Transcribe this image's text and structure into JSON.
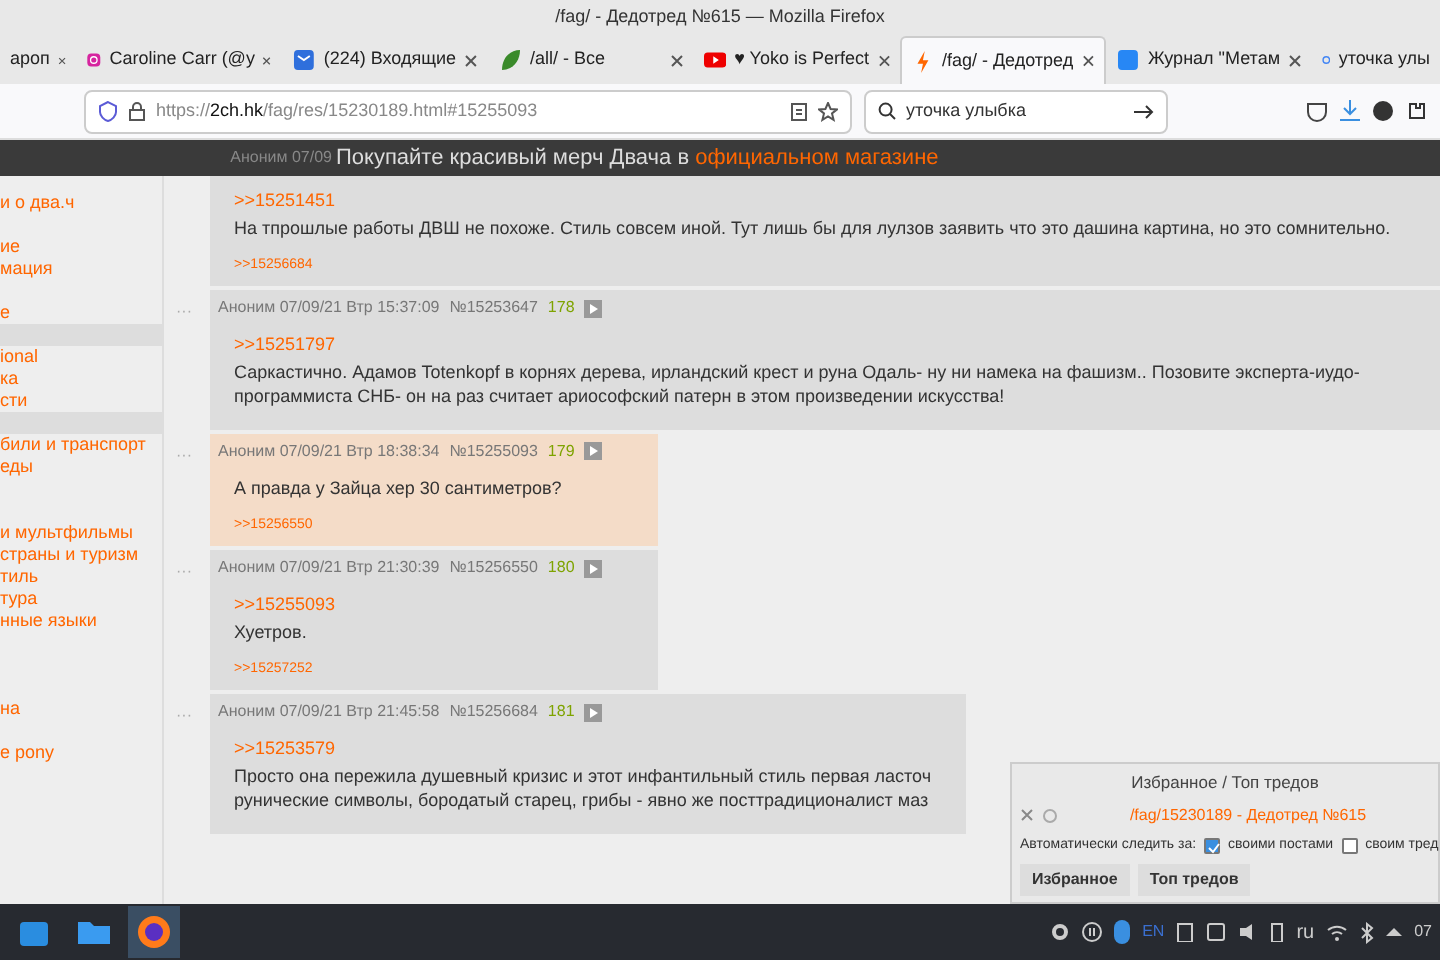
{
  "window": {
    "title": "/fag/ - Дедотред №615 — Mozilla Firefox"
  },
  "tabs": [
    {
      "label": "ароп",
      "selected": false
    },
    {
      "label": "Caroline Carr (@y",
      "selected": false
    },
    {
      "label": "(224) Входящие",
      "selected": false
    },
    {
      "label": "/all/ - Все",
      "selected": false
    },
    {
      "label": "♥ Yoko is Perfect",
      "selected": false
    },
    {
      "label": "/fag/ - Дедотред",
      "selected": true
    },
    {
      "label": "Журнал \"Метам",
      "selected": false
    },
    {
      "label": "уточка улы",
      "selected": false
    }
  ],
  "url_bar": {
    "scheme": "https://",
    "host": "2ch.hk",
    "path": "/fag/res/15230189.html#15255093"
  },
  "search": {
    "value": "уточка улыбка"
  },
  "banner": {
    "behind_text": "Аноним 07/09",
    "text": "Покупайте красивый мерч Двача в ",
    "link": "официальном магазине"
  },
  "sidebar": {
    "items": [
      {
        "kind": "link",
        "label": "и о два.ч"
      },
      {
        "kind": "gap"
      },
      {
        "kind": "link",
        "label": "ие"
      },
      {
        "kind": "link",
        "label": "мация"
      },
      {
        "kind": "gap"
      },
      {
        "kind": "link",
        "label": "е"
      },
      {
        "kind": "header"
      },
      {
        "kind": "link",
        "label": "ional"
      },
      {
        "kind": "link",
        "label": "ка"
      },
      {
        "kind": "link",
        "label": "сти"
      },
      {
        "kind": "header"
      },
      {
        "kind": "link",
        "label": "били и транспорт"
      },
      {
        "kind": "link",
        "label": "еды"
      },
      {
        "kind": "gap"
      },
      {
        "kind": "gap"
      },
      {
        "kind": "link",
        "label": "и мультфильмы"
      },
      {
        "kind": "link",
        "label": "страны и туризм"
      },
      {
        "kind": "link",
        "label": "тиль"
      },
      {
        "kind": "link",
        "label": "тура"
      },
      {
        "kind": "link",
        "label": "нные языки"
      },
      {
        "kind": "gap"
      },
      {
        "kind": "gap"
      },
      {
        "kind": "gap"
      },
      {
        "kind": "link",
        "label": "на"
      },
      {
        "kind": "gap"
      },
      {
        "kind": "link",
        "label": "e pony"
      }
    ]
  },
  "posts": [
    {
      "highlighted": false,
      "quote": ">>15251451",
      "lines": [
        "На тпрошлые работы ДВШ не похоже. Стиль совсем иной. Тут лишь бы для лулзов заявить что это дашина картина, но это сомнительно."
      ],
      "reply": ">>15256684"
    },
    {
      "marker": "···",
      "header": {
        "author_date": "Аноним 07/09/21 Втр 15:37:09",
        "number": "№15253647",
        "count": "178"
      },
      "highlighted": false,
      "quote": ">>15251797",
      "lines": [
        "Саркастично. Адамов Totenkopf в корнях дерева, ирландский крест и руна Одаль- ну ни намека на фашизм.. Позовите эксперта-иудо-программиста СНБ- он на раз считает ариософский патерн в этом произведении искусства!"
      ]
    },
    {
      "marker": "···",
      "header": {
        "author_date": "Аноним 07/09/21 Втр 18:38:34",
        "number": "№15255093",
        "count": "179"
      },
      "highlighted": true,
      "lines": [
        "А правда у Зайца хер 30 сантиметров?"
      ],
      "reply": ">>15256550"
    },
    {
      "marker": "···",
      "header": {
        "author_date": "Аноним 07/09/21 Втр 21:30:39",
        "number": "№15256550",
        "count": "180"
      },
      "highlighted": false,
      "quote": ">>15255093",
      "lines": [
        "Хуетров."
      ],
      "reply": ">>15257252"
    },
    {
      "marker": "···",
      "header": {
        "author_date": "Аноним 07/09/21 Втр 21:45:58",
        "number": "№15256684",
        "count": "181"
      },
      "highlighted": false,
      "quote": ">>15253579",
      "lines": [
        "Просто она пережила душевный кризис и этот инфантильный стиль первая ласточ",
        "рунические символы, бородатый старец, грибы - явно же посттрадиционалист маз"
      ]
    }
  ],
  "favorites_panel": {
    "title": "Избранное / Топ тредов",
    "thread_link": "/fag/15230189 - Дедотред №615",
    "auto_watch_label": "Автоматически следить за:",
    "options": [
      {
        "label": "своими постами",
        "checked": true
      },
      {
        "label": "своим тред",
        "checked": false
      }
    ],
    "buttons": [
      "Избранное",
      "Топ тредов"
    ]
  },
  "taskbar": {
    "language": "EN",
    "layout": "ru",
    "clock": "07"
  }
}
